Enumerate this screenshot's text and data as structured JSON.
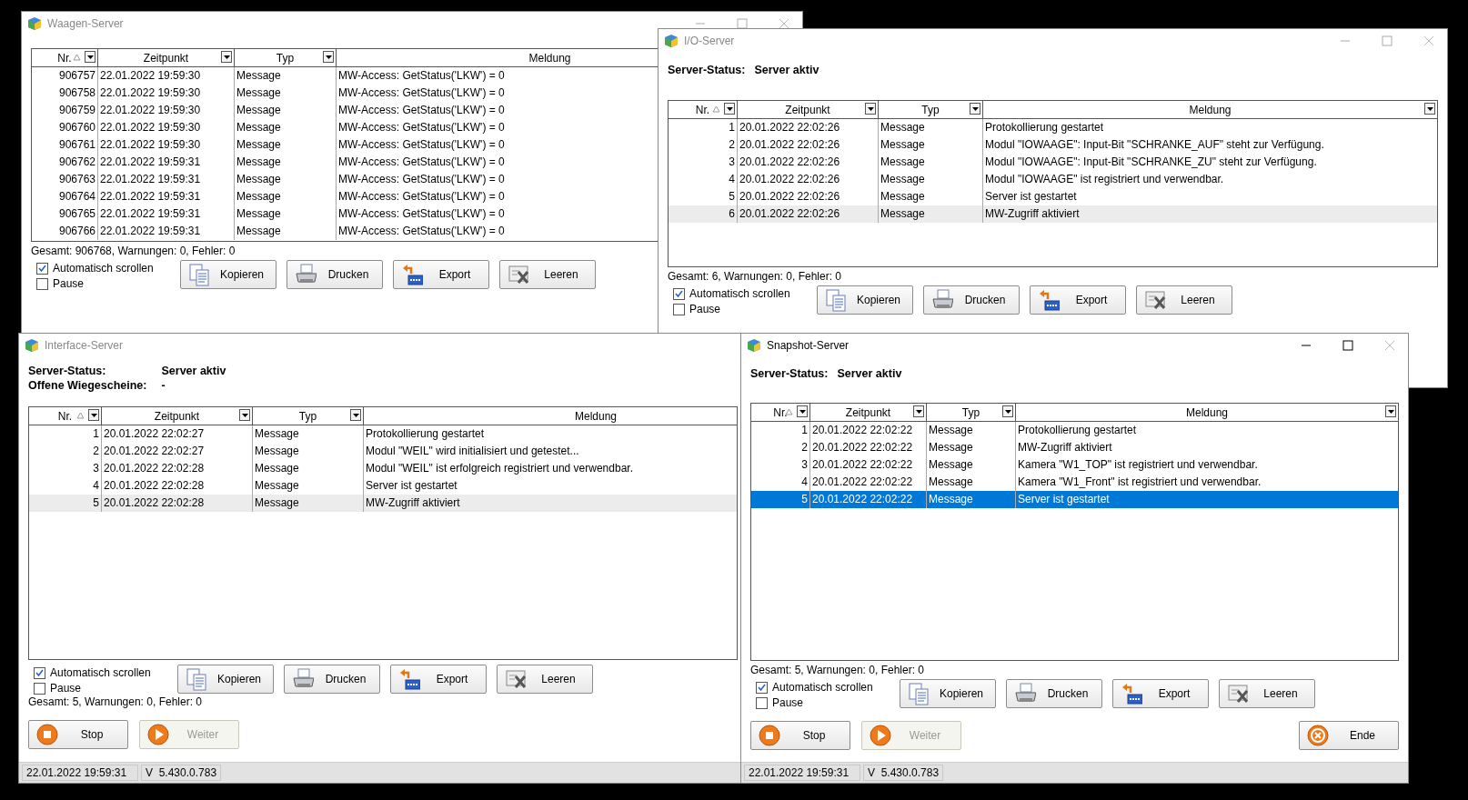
{
  "windows": [
    {
      "title": "Waagen-Server",
      "active": false,
      "caption_buttons": true,
      "table": {
        "columns": [
          {
            "label": "Nr.",
            "sorted": true,
            "dropdown": true
          },
          {
            "label": "Zeitpunkt",
            "sorted": false,
            "dropdown": true
          },
          {
            "label": "Typ",
            "sorted": false,
            "dropdown": true
          },
          {
            "label": "Meldung",
            "sorted": false,
            "dropdown": false
          }
        ],
        "rows": [
          {
            "cells": [
              "906757",
              "22.01.2022 19:59:30",
              "Message",
              "MW-Access: GetStatus('LKW') = 0"
            ],
            "selected": false
          },
          {
            "cells": [
              "906758",
              "22.01.2022 19:59:30",
              "Message",
              "MW-Access: GetStatus('LKW') = 0"
            ],
            "selected": false
          },
          {
            "cells": [
              "906759",
              "22.01.2022 19:59:30",
              "Message",
              "MW-Access: GetStatus('LKW') = 0"
            ],
            "selected": false
          },
          {
            "cells": [
              "906760",
              "22.01.2022 19:59:30",
              "Message",
              "MW-Access: GetStatus('LKW') = 0"
            ],
            "selected": false
          },
          {
            "cells": [
              "906761",
              "22.01.2022 19:59:30",
              "Message",
              "MW-Access: GetStatus('LKW') = 0"
            ],
            "selected": false
          },
          {
            "cells": [
              "906762",
              "22.01.2022 19:59:31",
              "Message",
              "MW-Access: GetStatus('LKW') = 0"
            ],
            "selected": false
          },
          {
            "cells": [
              "906763",
              "22.01.2022 19:59:31",
              "Message",
              "MW-Access: GetStatus('LKW') = 0"
            ],
            "selected": false
          },
          {
            "cells": [
              "906764",
              "22.01.2022 19:59:31",
              "Message",
              "MW-Access: GetStatus('LKW') = 0"
            ],
            "selected": false
          },
          {
            "cells": [
              "906765",
              "22.01.2022 19:59:31",
              "Message",
              "MW-Access: GetStatus('LKW') = 0"
            ],
            "selected": false
          },
          {
            "cells": [
              "906766",
              "22.01.2022 19:59:31",
              "Message",
              "MW-Access: GetStatus('LKW') = 0"
            ],
            "selected": false
          }
        ]
      },
      "summary": "Gesamt: 906768, Warnungen: 0, Fehler: 0",
      "options": [
        {
          "label": "Automatisch scrollen",
          "checked": true
        },
        {
          "label": "Pause",
          "checked": false
        }
      ],
      "buttons": [
        {
          "label": "Kopieren",
          "kind": "copy"
        },
        {
          "label": "Drucken",
          "kind": "print"
        },
        {
          "label": "Export",
          "kind": "export"
        },
        {
          "label": "Leeren",
          "kind": "clear"
        }
      ]
    },
    {
      "title": "I/O-Server",
      "active": false,
      "caption_buttons": true,
      "status_fields": [
        {
          "label": "Server-Status:",
          "value": "Server aktiv"
        }
      ],
      "table": {
        "columns": [
          {
            "label": "Nr.",
            "sorted": true,
            "dropdown": true
          },
          {
            "label": "Zeitpunkt",
            "sorted": false,
            "dropdown": true
          },
          {
            "label": "Typ",
            "sorted": false,
            "dropdown": true
          },
          {
            "label": "Meldung",
            "sorted": false,
            "dropdown": true
          }
        ],
        "rows": [
          {
            "cells": [
              "1",
              "20.01.2022 22:02:26",
              "Message",
              "Protokollierung gestartet"
            ],
            "selected": false
          },
          {
            "cells": [
              "2",
              "20.01.2022 22:02:26",
              "Message",
              "Modul \"IOWAAGE\": Input-Bit \"SCHRANKE_AUF\" steht zur Verfügung."
            ],
            "selected": false
          },
          {
            "cells": [
              "3",
              "20.01.2022 22:02:26",
              "Message",
              "Modul \"IOWAAGE\": Input-Bit \"SCHRANKE_ZU\" steht zur Verfügung."
            ],
            "selected": false
          },
          {
            "cells": [
              "4",
              "20.01.2022 22:02:26",
              "Message",
              "Modul \"IOWAAGE\" ist registriert und verwendbar."
            ],
            "selected": false
          },
          {
            "cells": [
              "5",
              "20.01.2022 22:02:26",
              "Message",
              "Server ist gestartet"
            ],
            "selected": false
          },
          {
            "cells": [
              "6",
              "20.01.2022 22:02:26",
              "Message",
              "MW-Zugriff aktiviert"
            ],
            "selected": true
          }
        ]
      },
      "summary": "Gesamt: 6, Warnungen: 0, Fehler: 0",
      "options": [
        {
          "label": "Automatisch scrollen",
          "checked": true
        },
        {
          "label": "Pause",
          "checked": false
        }
      ],
      "buttons": [
        {
          "label": "Kopieren",
          "kind": "copy"
        },
        {
          "label": "Drucken",
          "kind": "print"
        },
        {
          "label": "Export",
          "kind": "export"
        },
        {
          "label": "Leeren",
          "kind": "clear"
        }
      ]
    },
    {
      "title": "Interface-Server",
      "active": false,
      "caption_buttons": false,
      "status_fields": [
        {
          "label": "Server-Status:",
          "value": "Server aktiv"
        },
        {
          "label": "Offene Wiegescheine:",
          "value": "-"
        }
      ],
      "table": {
        "columns": [
          {
            "label": "Nr.",
            "sorted": true,
            "dropdown": true
          },
          {
            "label": "Zeitpunkt",
            "sorted": false,
            "dropdown": true
          },
          {
            "label": "Typ",
            "sorted": false,
            "dropdown": true
          },
          {
            "label": "Meldung",
            "sorted": false,
            "dropdown": false
          }
        ],
        "rows": [
          {
            "cells": [
              "1",
              "20.01.2022 22:02:27",
              "Message",
              "Protokollierung gestartet"
            ],
            "selected": false
          },
          {
            "cells": [
              "2",
              "20.01.2022 22:02:27",
              "Message",
              "Modul \"WEIL\" wird initialisiert und getestet..."
            ],
            "selected": false
          },
          {
            "cells": [
              "3",
              "20.01.2022 22:02:28",
              "Message",
              "Modul \"WEIL\" ist erfolgreich registriert und verwendbar."
            ],
            "selected": false
          },
          {
            "cells": [
              "4",
              "20.01.2022 22:02:28",
              "Message",
              "Server ist gestartet"
            ],
            "selected": false
          },
          {
            "cells": [
              "5",
              "20.01.2022 22:02:28",
              "Message",
              "MW-Zugriff aktiviert"
            ],
            "selected": true
          }
        ]
      },
      "options": [
        {
          "label": "Automatisch scrollen",
          "checked": true
        },
        {
          "label": "Pause",
          "checked": false
        }
      ],
      "buttons": [
        {
          "label": "Kopieren",
          "kind": "copy"
        },
        {
          "label": "Drucken",
          "kind": "print"
        },
        {
          "label": "Export",
          "kind": "export"
        },
        {
          "label": "Leeren",
          "kind": "clear"
        }
      ],
      "summary": "Gesamt: 5, Warnungen: 0, Fehler: 0",
      "actions": [
        {
          "label": "Stop",
          "kind": "stop",
          "disabled": false
        },
        {
          "label": "Weiter",
          "kind": "play",
          "disabled": true
        }
      ],
      "status_bar": [
        "22.01.2022 19:59:31",
        "V  5.430.0.783"
      ]
    },
    {
      "title": "Snapshot-Server",
      "active": true,
      "caption_buttons": true,
      "status_fields": [
        {
          "label": "Server-Status:",
          "value": "Server aktiv"
        }
      ],
      "table": {
        "columns": [
          {
            "label": "Nr.",
            "sorted": true,
            "dropdown": true
          },
          {
            "label": "Zeitpunkt",
            "sorted": false,
            "dropdown": true
          },
          {
            "label": "Typ",
            "sorted": false,
            "dropdown": true
          },
          {
            "label": "Meldung",
            "sorted": false,
            "dropdown": true
          }
        ],
        "rows": [
          {
            "cells": [
              "1",
              "20.01.2022 22:02:22",
              "Message",
              "Protokollierung gestartet"
            ],
            "selected": false
          },
          {
            "cells": [
              "2",
              "20.01.2022 22:02:22",
              "Message",
              "MW-Zugriff aktiviert"
            ],
            "selected": false
          },
          {
            "cells": [
              "3",
              "20.01.2022 22:02:22",
              "Message",
              "Kamera \"W1_TOP\" ist registriert und verwendbar."
            ],
            "selected": false
          },
          {
            "cells": [
              "4",
              "20.01.2022 22:02:22",
              "Message",
              "Kamera \"W1_Front\" ist registriert und verwendbar."
            ],
            "selected": false
          },
          {
            "cells": [
              "5",
              "20.01.2022 22:02:22",
              "Message",
              "Server ist gestartet"
            ],
            "selected": true
          }
        ]
      },
      "summary": "Gesamt: 5, Warnungen: 0, Fehler: 0",
      "options": [
        {
          "label": "Automatisch scrollen",
          "checked": true
        },
        {
          "label": "Pause",
          "checked": false
        }
      ],
      "buttons": [
        {
          "label": "Kopieren",
          "kind": "copy"
        },
        {
          "label": "Drucken",
          "kind": "print"
        },
        {
          "label": "Export",
          "kind": "export"
        },
        {
          "label": "Leeren",
          "kind": "clear"
        }
      ],
      "actions": [
        {
          "label": "Stop",
          "kind": "stop",
          "disabled": false
        },
        {
          "label": "Weiter",
          "kind": "play",
          "disabled": true
        },
        {
          "label": "Ende",
          "kind": "end",
          "disabled": false
        }
      ],
      "status_bar": [
        "22.01.2022 19:59:31",
        "V  5.430.0.783"
      ]
    }
  ]
}
